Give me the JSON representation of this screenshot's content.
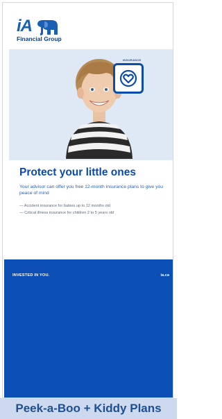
{
  "logo": {
    "brand": "iA",
    "tagline": "Financial Group"
  },
  "hero": {
    "badge_label": "INSURANCE"
  },
  "content": {
    "title": "Protect your little ones",
    "intro": "Your advisor can offer you free 12-month insurance plans to give you peace of mind",
    "bullets": [
      "— Accident insurance for babies up to 12 months old",
      "— Critical illness insurance for children 2 to 5 years old"
    ]
  },
  "footer": {
    "slogan": "INVESTED IN YOU.",
    "website": "ia.ca"
  },
  "banner": {
    "caption": "Peek-a-Boo + Kiddy Plans"
  },
  "colors": {
    "brand_blue": "#0b4fb5",
    "title_blue": "#0a4ab0",
    "hero_bg": "#dfe9f6",
    "banner_bg": "#ccd9ee"
  }
}
